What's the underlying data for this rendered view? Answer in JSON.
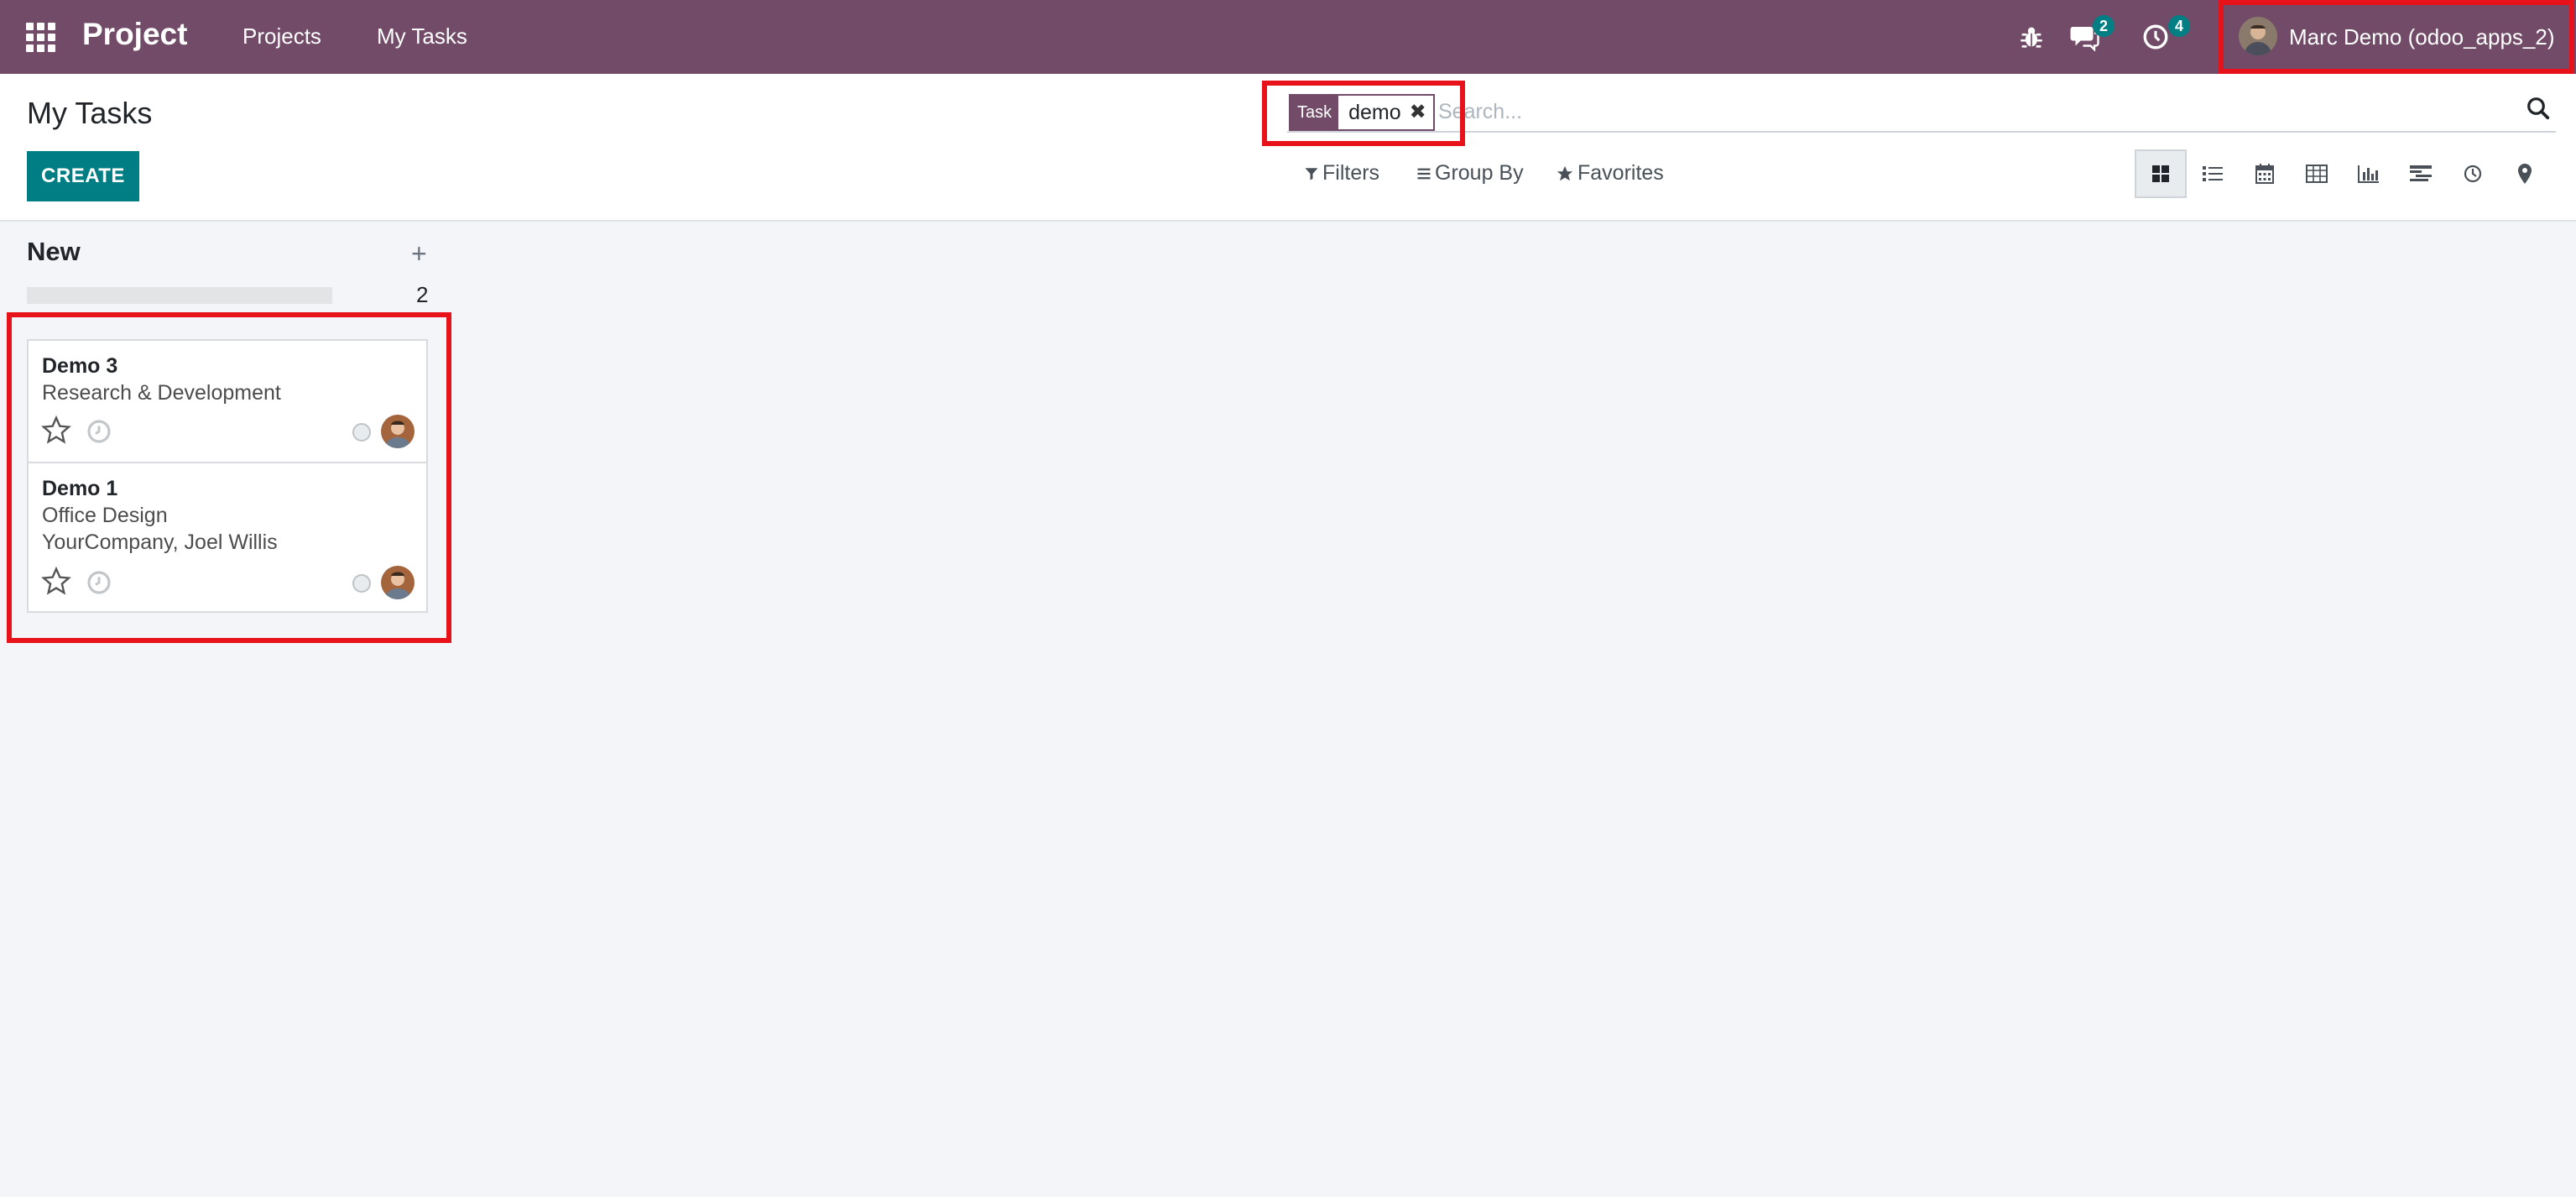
{
  "navbar": {
    "brand": "Project",
    "menu": [
      "Projects",
      "My Tasks"
    ],
    "messages_count": "2",
    "activities_count": "4",
    "user_name": "Marc Demo (odoo_apps_2)",
    "bg_color": "#714b67",
    "badge_color": "#017e84"
  },
  "control": {
    "title": "My Tasks",
    "create_label": "CREATE",
    "search": {
      "facet_category": "Task",
      "facet_value": "demo",
      "placeholder": "Search..."
    },
    "filters_label": "Filters",
    "groupby_label": "Group By",
    "favorites_label": "Favorites",
    "views": [
      "kanban-icon",
      "list-icon",
      "calendar-icon",
      "pivot-icon",
      "graph-icon",
      "gantt-icon",
      "activity-icon",
      "map-icon"
    ]
  },
  "kanban": {
    "column": {
      "title": "New",
      "count": "2"
    },
    "cards": [
      {
        "title": "Demo 3",
        "lines": [
          "Research & Development"
        ]
      },
      {
        "title": "Demo 1",
        "lines": [
          "Office Design",
          "YourCompany, Joel Willis"
        ]
      }
    ]
  },
  "accent_color": "#017e84"
}
